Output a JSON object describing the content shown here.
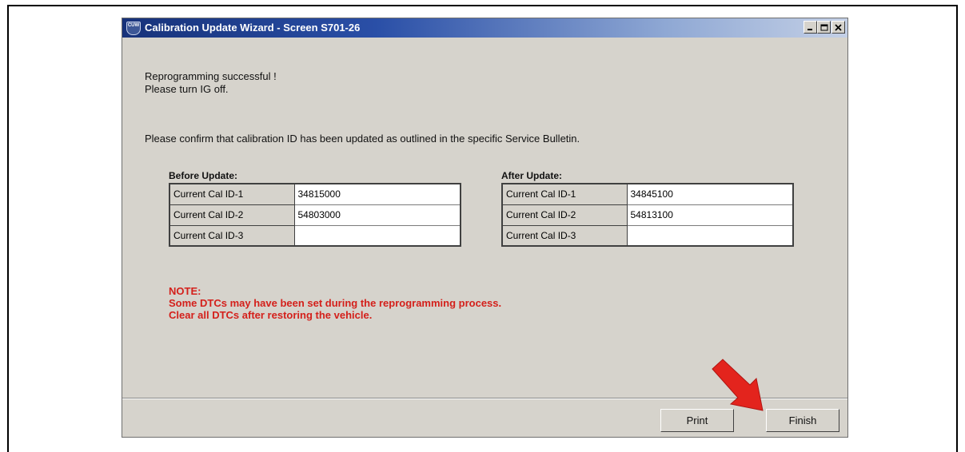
{
  "window": {
    "icon_text": "CUW",
    "title": "Calibration Update Wizard - Screen S701-26",
    "controls": [
      "minimize",
      "maximize",
      "close"
    ]
  },
  "messages": {
    "line1": "Reprogramming successful !",
    "line2": "Please turn IG off.",
    "confirm": "Please confirm that calibration ID has been updated as outlined in the specific Service Bulletin."
  },
  "before": {
    "label": "Before Update:",
    "rows": [
      {
        "name": "Current Cal ID-1",
        "value": "34815000"
      },
      {
        "name": "Current Cal ID-2",
        "value": "54803000"
      },
      {
        "name": "Current Cal ID-3",
        "value": ""
      }
    ]
  },
  "after": {
    "label": "After Update:",
    "rows": [
      {
        "name": "Current Cal ID-1",
        "value": "34845100"
      },
      {
        "name": "Current Cal ID-2",
        "value": "54813100"
      },
      {
        "name": "Current Cal ID-3",
        "value": ""
      }
    ]
  },
  "note": {
    "heading": "NOTE:",
    "line1": "Some DTCs may have been set during the reprogramming process.",
    "line2": "Clear all DTCs after restoring the vehicle."
  },
  "buttons": {
    "print": "Print",
    "finish": "Finish"
  },
  "colors": {
    "note_text": "#d4201b",
    "arrow": "#e3241d",
    "title_bar": "#17327a"
  }
}
